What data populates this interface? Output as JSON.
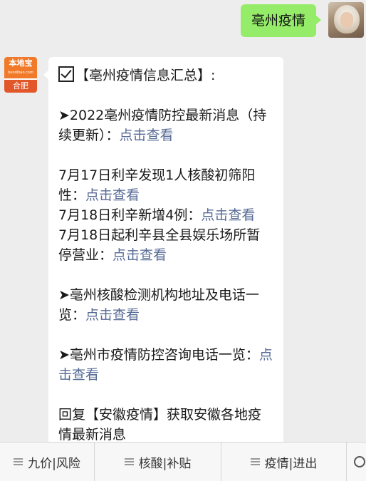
{
  "outgoing": {
    "text": "亳州疫情"
  },
  "bot": {
    "brand": "本地宝",
    "brand_sub": "bendibao.com",
    "city": "合肥"
  },
  "card": {
    "header": "【亳州疫情信息汇总】:",
    "item1_text": "➤2022亳州疫情防控最新消息（持续更新）：",
    "item1_link": "点击查看",
    "news1_text": "7月17日利辛发现1人核酸初筛阳性：",
    "news1_link": "点击查看",
    "news2_text": "7月18日利辛新增4例：",
    "news2_link": "点击查看",
    "news3_text": "7月18日起利辛县全县娱乐场所暂停营业：",
    "news3_link": "点击查看",
    "item2_text": "➤亳州核酸检测机构地址及电话一览：",
    "item2_link": "点击查看",
    "item3_text": "➤亳州市疫情防控咨询电话一览：",
    "item3_link": "点击查看",
    "footer_text": "回复【安徽疫情】获取安徽各地疫情最新消息"
  },
  "menu": [
    "九价|风险",
    "核酸|补贴",
    "疫情|进出"
  ],
  "icons": {
    "keyboard": "keyboard-toggle-icon",
    "menu": "menu-lines-icon"
  },
  "colors": {
    "bubble_green": "#95ec69",
    "link": "#576b95",
    "brand": "#f07a2a"
  }
}
